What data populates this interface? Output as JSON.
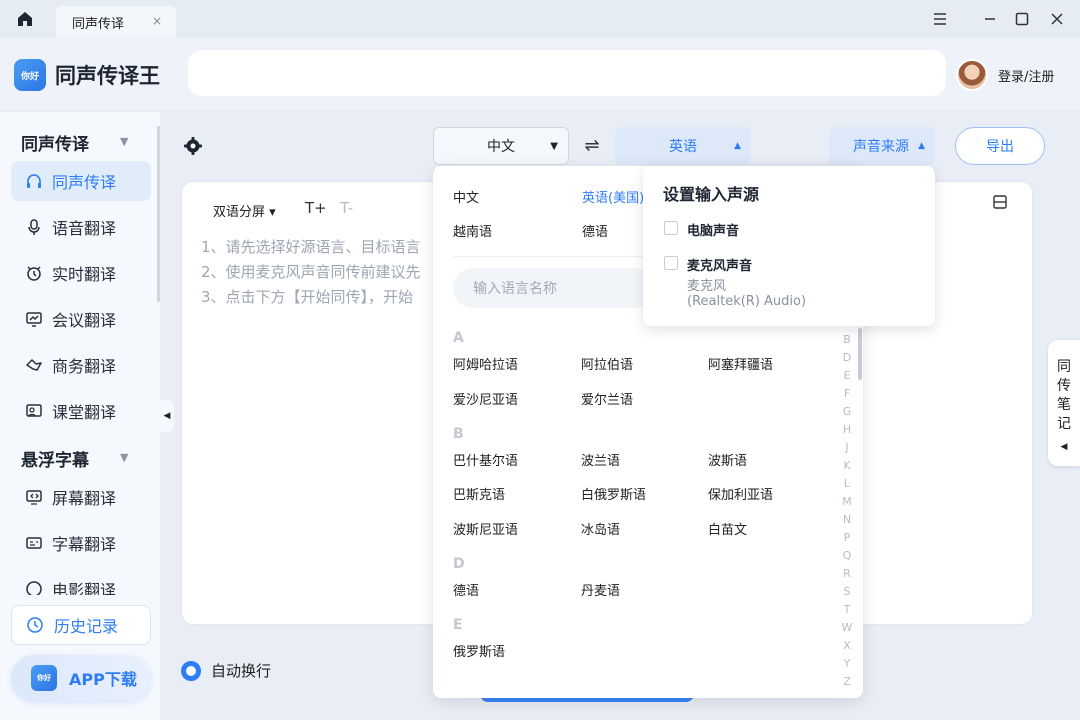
{
  "titlebar": {
    "tab_label": "同声传译",
    "tab_close": "×"
  },
  "header": {
    "app_name": "同声传译王",
    "login_label": "登录/注册",
    "logo_text": "你好"
  },
  "sidebar": {
    "section1": "同声传译",
    "items1": [
      "同声传译",
      "语音翻译",
      "实时翻译",
      "会议翻译",
      "商务翻译",
      "课堂翻译"
    ],
    "section2": "悬浮字幕",
    "items2": [
      "屏幕翻译",
      "字幕翻译",
      "电影翻译"
    ],
    "history": "历史记录",
    "app_download": "APP下载"
  },
  "toolbar": {
    "source_lang": "中文",
    "target_lang": "英语",
    "sound_source": "声音来源",
    "export": "导出"
  },
  "panel": {
    "bilingual": "双语分屏",
    "font_up": "T+",
    "font_down": "T-",
    "hints": [
      "1、请先选择好源语言、目标语言",
      "2、使用麦克风声音同传前建议先",
      "3、点击下方【开始同传】，开始"
    ]
  },
  "auto_wrap": "自动换行",
  "side_note": [
    "同",
    "传",
    "笔",
    "记"
  ],
  "lang_dropdown": {
    "recent": [
      [
        "中文",
        "英语(美国)"
      ],
      [
        "越南语",
        "德语"
      ]
    ],
    "search_placeholder": "输入语言名称",
    "groups": [
      {
        "letter": "A",
        "rows": [
          [
            "阿姆哈拉语",
            "阿拉伯语",
            "阿塞拜疆语"
          ],
          [
            "爱沙尼亚语",
            "爱尔兰语",
            ""
          ]
        ]
      },
      {
        "letter": "B",
        "rows": [
          [
            "巴什基尔语",
            "波兰语",
            "波斯语"
          ],
          [
            "巴斯克语",
            "白俄罗斯语",
            "保加利亚语"
          ],
          [
            "波斯尼亚语",
            "冰岛语",
            "白苗文"
          ]
        ]
      },
      {
        "letter": "D",
        "rows": [
          [
            "德语",
            "丹麦语",
            ""
          ]
        ]
      },
      {
        "letter": "E",
        "rows": [
          [
            "俄罗斯语",
            "",
            ""
          ]
        ]
      }
    ],
    "index": [
      "B",
      "D",
      "E",
      "F",
      "G",
      "H",
      "J",
      "K",
      "L",
      "M",
      "N",
      "P",
      "Q",
      "R",
      "S",
      "T",
      "W",
      "X",
      "Y",
      "Z"
    ]
  },
  "source_popup": {
    "title": "设置输入声源",
    "opt1": "电脑声音",
    "opt2": "麦克风声音",
    "opt2_sub1": "麦克风",
    "opt2_sub2": "(Realtek(R) Audio)"
  },
  "colors": {
    "accent": "#2e7cf6",
    "bg": "#e9eef6"
  }
}
